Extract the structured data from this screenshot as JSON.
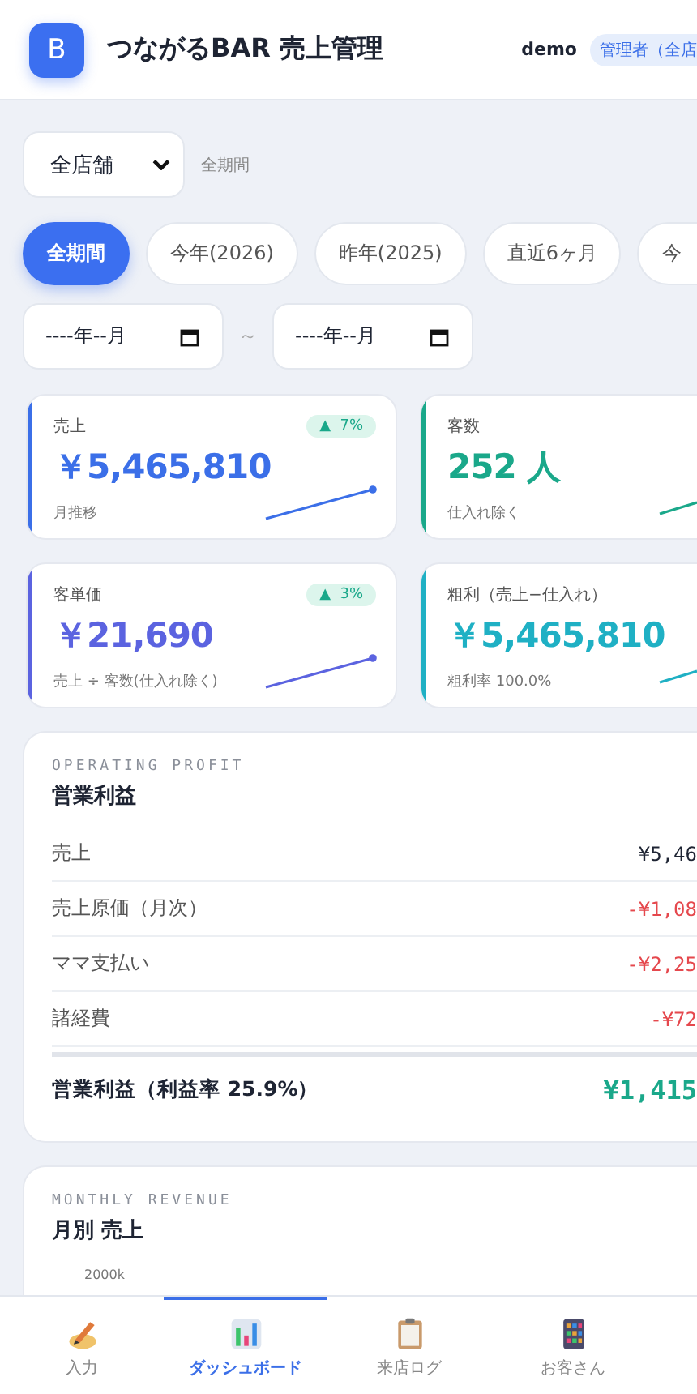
{
  "header": {
    "logo_letter": "B",
    "title": "つながるBAR 売上管理",
    "user": "demo",
    "role_badge": "管理者（全店"
  },
  "filters": {
    "store_select": "全店舗",
    "period_label": "全期間"
  },
  "period_chips": [
    {
      "label": "全期間",
      "selected": true
    },
    {
      "label": "今年(2026)",
      "selected": false
    },
    {
      "label": "昨年(2025)",
      "selected": false
    },
    {
      "label": "直近6ヶ月",
      "selected": false
    },
    {
      "label": "今",
      "selected": false
    }
  ],
  "date_range": {
    "from": "----年--月",
    "separator": "～",
    "to": "----年--月"
  },
  "kpi_cards": [
    {
      "label": "売上",
      "value": "￥5,465,810",
      "sub": "月推移",
      "color": "#3b6fe8",
      "badge": {
        "arrow": "▲",
        "text": "7%"
      }
    },
    {
      "label": "客数",
      "value": "252 人",
      "sub": "仕入れ除く",
      "color": "#1aa88a"
    },
    {
      "label": "客単価",
      "value": "￥21,690",
      "sub": "売上 ÷ 客数(仕入れ除く)",
      "color": "#5b63e0",
      "badge": {
        "arrow": "▲",
        "text": "3%"
      }
    },
    {
      "label": "粗利（売上−仕入れ）",
      "value": "￥5,465,810",
      "sub": "粗利率 100.0%",
      "color": "#1fb0c4"
    }
  ],
  "operating_profit": {
    "overline": "OPERATING PROFIT",
    "title": "営業利益",
    "rows": [
      {
        "label": "売上",
        "value": "¥5,46",
        "kind": "income"
      },
      {
        "label": "売上原価（月次）",
        "value": "-¥1,08",
        "kind": "expense"
      },
      {
        "label": "ママ支払い",
        "value": "-¥2,25",
        "kind": "expense"
      },
      {
        "label": "諸経費",
        "value": "-¥72",
        "kind": "expense"
      }
    ],
    "total": {
      "label": "営業利益（利益率 25.9%）",
      "value": "¥1,415"
    }
  },
  "monthly_revenue": {
    "overline": "MONTHLY REVENUE",
    "title": "月別 売上",
    "y_tick": "2000k"
  },
  "bottom_nav": [
    {
      "label": "入力",
      "kind": "input",
      "selected": false
    },
    {
      "label": "ダッシュボード",
      "kind": "dashboard",
      "selected": true
    },
    {
      "label": "来店ログ",
      "kind": "log",
      "selected": false
    },
    {
      "label": "お客さん",
      "kind": "customers",
      "selected": false
    }
  ]
}
